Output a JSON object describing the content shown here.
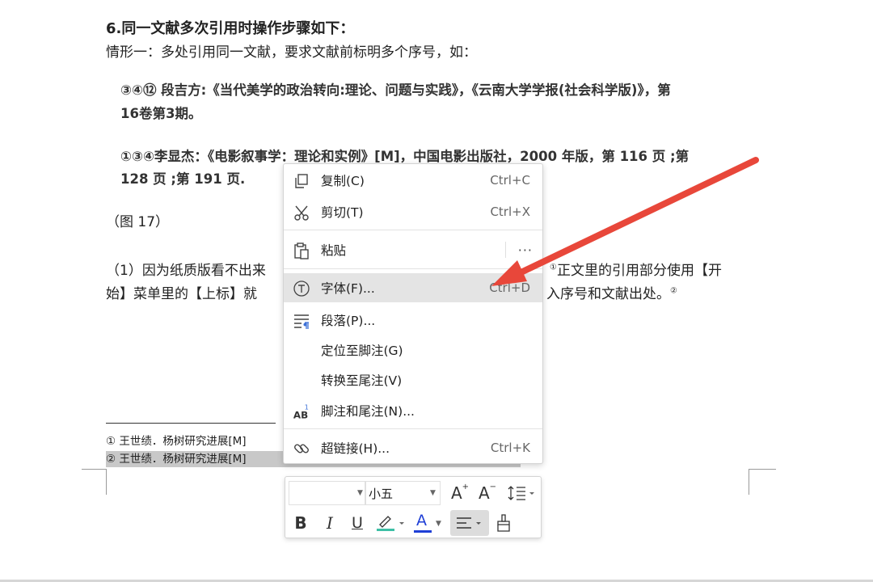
{
  "document": {
    "heading": "6.同一文献多次引用时操作步骤如下：",
    "case_one": "情形一：多处引用同一文献，要求文献前标明多个序号，如：",
    "citation1_line1": "③④⑫ 段吉方:《当代美学的政治转向:理论、问题与实践》，《云南大学学报(社会科学版)》，第",
    "citation1_line2": "16卷第3期。",
    "citation2_line1": "①③④李显杰：《电影叙事学：理论和实例》[M]，中国电影出版社，2000 年版，第 116 页 ;第",
    "citation2_line2": "128 页 ;第 191 页.",
    "figure_label": "（图 17）",
    "para1_start": "（1）因为纸质版看不出来",
    "para1_sup1": "①",
    "para1_end": "正文里的引用部分使用【开",
    "para2_start": "始】菜单里的【上标】就",
    "para2_end": "入序号和文献出处。",
    "para2_sup2": "②",
    "footnote1": "①  王世绩．杨树研究进展[M]",
    "footnote2": "②  王世绩．杨树研究进展[M]"
  },
  "context_menu": {
    "items": [
      {
        "label": "复制(C)",
        "shortcut": "Ctrl+C",
        "icon": "copy-icon"
      },
      {
        "label": "剪切(T)",
        "shortcut": "Ctrl+X",
        "icon": "scissors-icon"
      },
      {
        "label": "粘贴",
        "shortcut": "···",
        "icon": "paste-icon"
      },
      {
        "label": "字体(F)...",
        "shortcut": "Ctrl+D",
        "icon": "font-icon"
      },
      {
        "label": "段落(P)...",
        "shortcut": "",
        "icon": "paragraph-icon"
      },
      {
        "label": "定位至脚注(G)",
        "shortcut": "",
        "icon": ""
      },
      {
        "label": "转换至尾注(V)",
        "shortcut": "",
        "icon": ""
      },
      {
        "label": "脚注和尾注(N)...",
        "shortcut": "",
        "icon": "footnote-icon"
      },
      {
        "label": "超链接(H)...",
        "shortcut": "Ctrl+K",
        "icon": "link-icon"
      }
    ],
    "hovered_index": 3
  },
  "mini_toolbar": {
    "font_name": "",
    "font_size": "小五",
    "grow_font": "A",
    "shrink_font": "A",
    "bold": "B",
    "italic": "I",
    "underline": "U",
    "font_color_glyph": "A",
    "highlight_color": "#3dbfa5",
    "font_color": "#1f3fd6"
  },
  "annotation": {
    "arrow_color": "#e8473a"
  }
}
